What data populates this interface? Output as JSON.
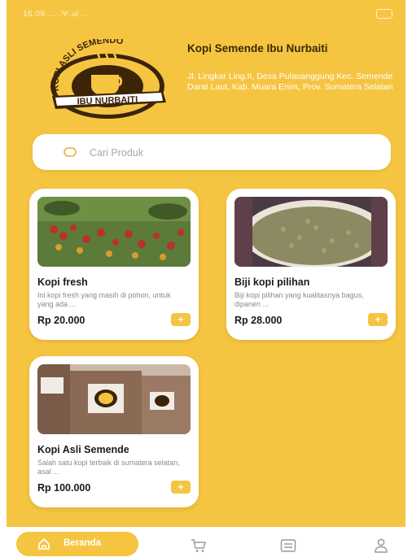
{
  "status_bar": {
    "time": "16.09 ...·.Ψ.ul ..."
  },
  "header": {
    "logo_text_top": "KOPI ASLI SEMENDO",
    "logo_text_bottom": "IBU NURBAITI",
    "shop_name": "Kopi Semende Ibu Nurbaiti",
    "address": "Jl. Lingkar Ling.II, Desa Pulauanggung Kec. Semende Darat Laut, Kab. Muara Enim, Prov. Sumatera Selatan"
  },
  "search": {
    "placeholder": "Cari Produk",
    "icon": "search-icon"
  },
  "products": [
    {
      "title": "Kopi fresh",
      "description": "Ini kopi fresh yang masih di pohon, untuk yang ada ...",
      "price": "Rp 20.000",
      "add_label": "+"
    },
    {
      "title": "Biji kopi pilihan",
      "description": "Biji kopi pilihan yang kualitasnya bagus, dipanen ...",
      "price": "Rp 28.000",
      "add_label": "+"
    },
    {
      "title": "Kopi Asli Semende",
      "description": "Salah satu kopi terbaik di sumatera selatan, asal ...",
      "price": "Rp 100.000",
      "add_label": "+"
    }
  ],
  "bottom_nav": {
    "home_label": "Beranda",
    "icons": [
      "home-icon",
      "cart-icon",
      "order-list-icon",
      "profile-icon"
    ]
  },
  "colors": {
    "primary": "#f5c542",
    "dark_text": "#1a1a1a",
    "brand_brown": "#3a2a00"
  }
}
